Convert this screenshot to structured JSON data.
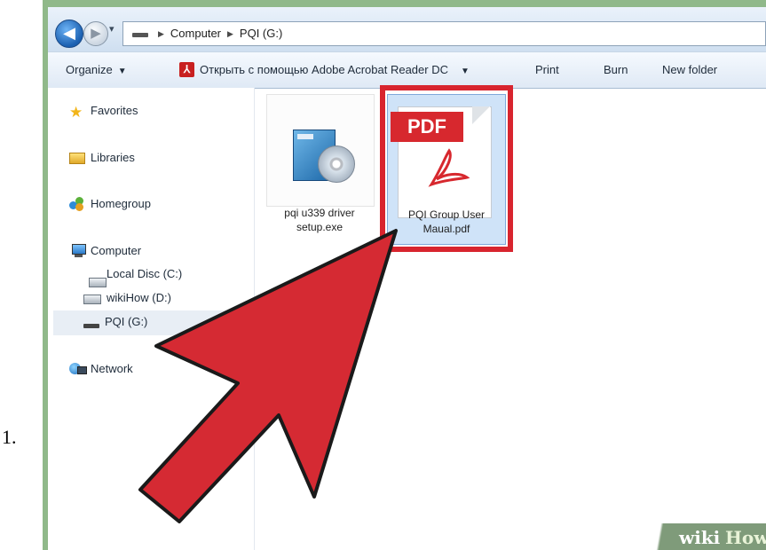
{
  "step_number": "1.",
  "address_bar": {
    "crumbs": [
      "Computer",
      "PQI (G:)"
    ],
    "dropdown_glyph": "▾"
  },
  "toolbar": {
    "organize": "Organize",
    "open_with": "Открыть с помощью Adobe Acrobat Reader DC",
    "print": "Print",
    "burn": "Burn",
    "new_folder": "New folder"
  },
  "sidebar": {
    "favorites": "Favorites",
    "libraries": "Libraries",
    "homegroup": "Homegroup",
    "computer": "Computer",
    "local_disc": "Local Disc (C:)",
    "wikihow_drive": "wikiHow (D:)",
    "pqi_drive": "PQI (G:)",
    "network": "Network"
  },
  "files": [
    {
      "line1": "pqi u339 driver",
      "line2": "setup.exe",
      "icon": "installer-icon"
    },
    {
      "line1": "PQI Group User",
      "line2": "Maual.pdf",
      "icon": "pdf-icon",
      "banner": "PDF"
    }
  ],
  "colors": {
    "highlight": "#d8242e",
    "arrow": "#d52a33",
    "selection": "#cfe3f8"
  },
  "watermark": {
    "part1": "wiki",
    "part2": "How"
  }
}
